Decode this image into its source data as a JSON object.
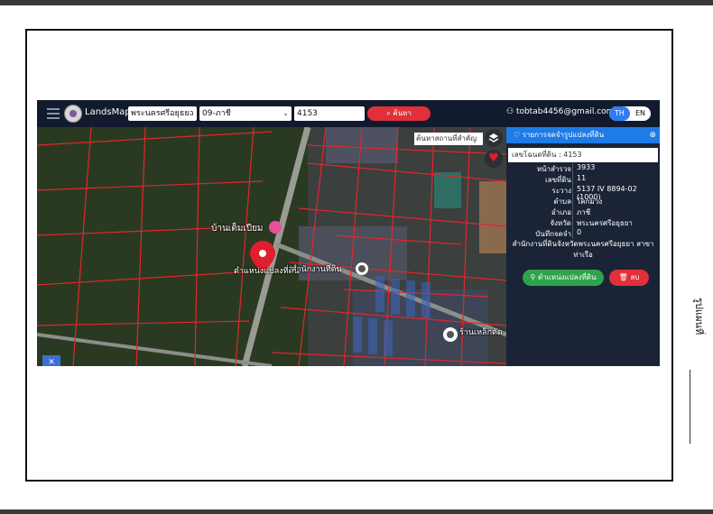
{
  "side_caption": "รูปแผนที่",
  "app": {
    "brand": "LandsMaps",
    "province": "พระนครศรีอยุธยา",
    "district": "09-ภาชี",
    "parcel_query": "4153",
    "search_label": "ค้นหา",
    "user_email": "tobtab4456@gmail.com",
    "lang_th": "TH",
    "lang_en": "EN"
  },
  "map": {
    "search_placeholder": "ค้นหาสถานที่สำคัญ",
    "label_village": "บ้านเต็มเปียม",
    "label_marker": "ตำแหน่งแปลงที่ดิน",
    "label_road": "สำนักงานที่ดิน",
    "label_shop": "ร้านเหล็กตัด"
  },
  "panel": {
    "title": "รายการจดจำรูปแปลงที่ดิน",
    "parcel_label": "เลขโฉนดที่ดิน : 4153",
    "rows": [
      {
        "k": "หน้าสำรวจ",
        "v": "3933"
      },
      {
        "k": "เลขที่ดิน",
        "v": "11"
      },
      {
        "k": "ระวาง",
        "v": "5137 IV 8894-02 (1000)"
      },
      {
        "k": "ตำบล",
        "v": "โคกม่วง"
      },
      {
        "k": "อำเภอ",
        "v": "ภาชี"
      },
      {
        "k": "จังหวัด",
        "v": "พระนครศรีอยุธยา"
      },
      {
        "k": "บันทึกจดจำ",
        "v": "0"
      }
    ],
    "office": "สำนักงานที่ดินจังหวัดพระนครศรีอยุธยา สาขาท่าเรือ",
    "locate_button": "ตำแหน่งแปลงที่ดิน",
    "delete_button": "ลบ"
  },
  "colors": {
    "nav": "#121b2e",
    "accent_blue": "#1f7be5",
    "search_red": "#e0303a",
    "locate_green": "#2fa34a",
    "parcel_line": "#e3262b"
  }
}
